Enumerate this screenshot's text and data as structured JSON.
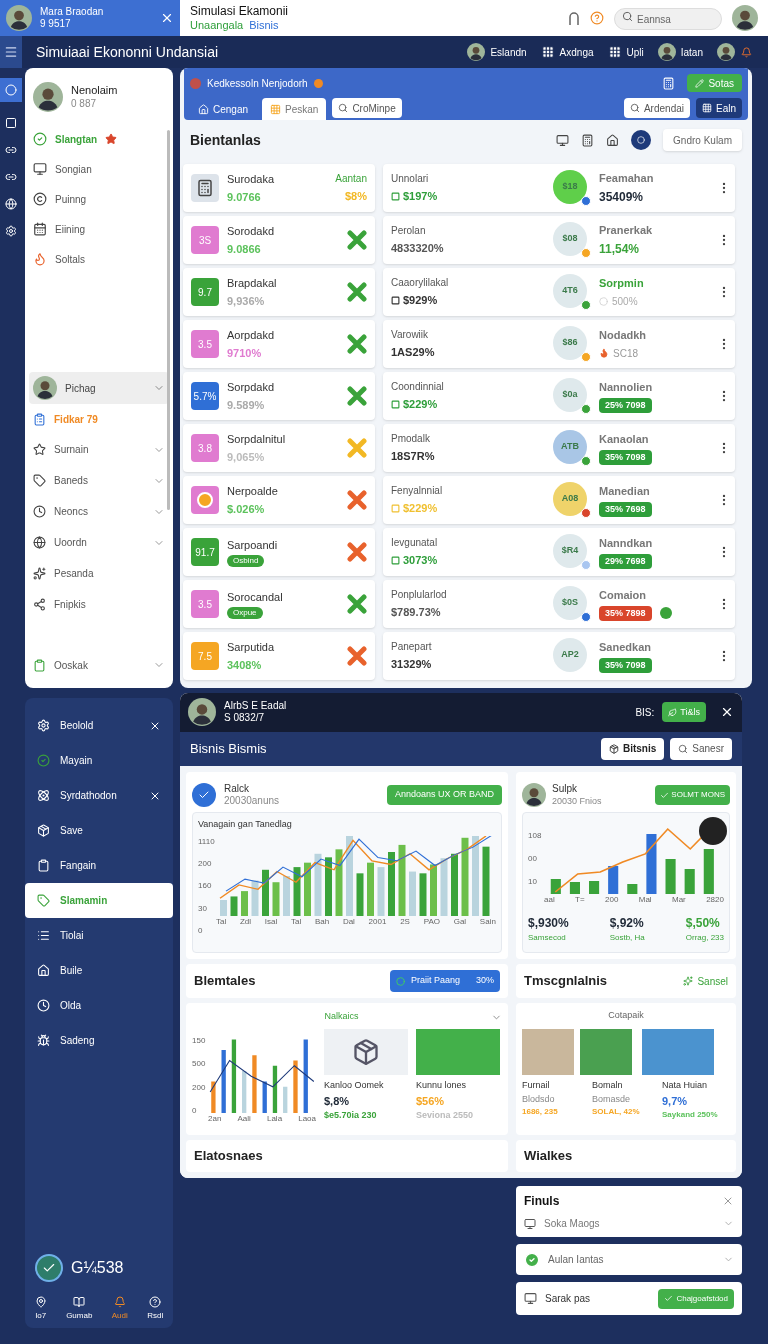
{
  "top_bar": {
    "user_name": "Mara Braodan",
    "user_id": "9 9517",
    "title": "Simulasi Ekamonii",
    "subtitle_first": "Unaangala",
    "subtitle_second": "Bisnis",
    "search_placeholder": "Eannsa"
  },
  "header": {
    "title": "Simuiaai Ekononni Undansiai",
    "items": [
      {
        "kind": "avatar",
        "label": "Eslandn"
      },
      {
        "kind": "square",
        "label": "Axdnga"
      },
      {
        "kind": "square",
        "label": "Upli"
      },
      {
        "kind": "avatar",
        "label": "Iatan"
      }
    ]
  },
  "sidebar": {
    "name": "Nenolaim",
    "id": "0 887",
    "items": [
      {
        "label": "Slangtan",
        "selected": true,
        "starred": true
      },
      {
        "label": "Songian",
        "selected": false,
        "starred": false
      },
      {
        "label": "Puinng",
        "selected": false,
        "starred": false
      },
      {
        "label": "Eiining",
        "selected": false,
        "starred": false
      },
      {
        "label": "Soltals",
        "selected": false,
        "starred": false
      }
    ],
    "group": "Pichag",
    "highlight": "Fidkar 79",
    "sub_items": [
      {
        "label": "Surnain",
        "chevron": true
      },
      {
        "label": "Baneds",
        "chevron": true
      },
      {
        "label": "Neoncs",
        "chevron": true
      },
      {
        "label": "Uoordn",
        "chevron": true
      },
      {
        "label": "Pesanda",
        "chevron": false
      },
      {
        "label": "Fnipkis",
        "chevron": false
      }
    ],
    "footer_item": "Ooskak"
  },
  "panel": {
    "title": "Kedkessoln Nenjodorh",
    "action": "Sotas",
    "tabs": [
      {
        "label": "Cengan",
        "selected": false
      },
      {
        "label": "Peskan",
        "selected": true
      }
    ],
    "filter": "CroMinpe",
    "search": "Ardendai",
    "view_button": "Ealn"
  },
  "list": {
    "title": "Bientanlas",
    "button": "Gndro Kulam",
    "rows": [
      {
        "thumb": {
          "kind": "register"
        },
        "name": "Surodaka",
        "value": {
          "kind": "text",
          "text": "9.0766",
          "color": "#5cc25c"
        },
        "status": {
          "kind": "note",
          "note": "Aantan",
          "note_value": "$8%"
        },
        "label": "Unnolari",
        "value2": {
          "text": "$197%",
          "color": "#2e9e3a",
          "icon": true
        },
        "badge": {
          "text": "$18",
          "color": "#5fcf4a"
        },
        "dot": {
          "color": "#2f6fd6"
        },
        "label3": {
          "text": "Feamahan",
          "color": "#777777"
        },
        "value3": {
          "kind": "text",
          "text": "35409%",
          "color": "#1f2937"
        },
        "extra_dot": false
      },
      {
        "thumb": {
          "kind": "text",
          "text": "3S",
          "color": "#e07bd0"
        },
        "name": "Sorodakd",
        "value": {
          "kind": "text",
          "text": "9.0866",
          "color": "#5cc25c"
        },
        "status": {
          "kind": "ok"
        },
        "label": "Perolan",
        "value2": {
          "text": "4833320%",
          "color": "#555555",
          "icon": false
        },
        "badge": {
          "text": "$08",
          "color": "#dfe9ec"
        },
        "dot": {
          "color": "#f5a623"
        },
        "label3": {
          "text": "Pranerkak",
          "color": "#777777"
        },
        "value3": {
          "kind": "text",
          "text": "11,54%",
          "color": "#3aa33a"
        },
        "extra_dot": false
      },
      {
        "thumb": {
          "kind": "text",
          "text": "9.7",
          "color": "#3aa33a"
        },
        "name": "Brapdakal",
        "value": {
          "kind": "text",
          "text": "9,936%",
          "color": "#aaaaaa"
        },
        "status": {
          "kind": "ok"
        },
        "label": "Caaorylilakal",
        "value2": {
          "text": "$929%",
          "color": "#333333",
          "icon": true
        },
        "badge": {
          "text": "4T6",
          "color": "#dfe9ec"
        },
        "dot": {
          "color": "#3aa33a"
        },
        "label3": {
          "text": "Sorpmin",
          "color": "#3aa33a"
        },
        "value3": {
          "kind": "spinner",
          "text": "500%",
          "color": "#aaaaaa"
        },
        "extra_dot": false
      },
      {
        "thumb": {
          "kind": "text",
          "text": "3.5",
          "color": "#e07bd0"
        },
        "name": "Aorpdakd",
        "value": {
          "kind": "text",
          "text": "9710%",
          "color": "#e07bd0"
        },
        "status": {
          "kind": "ok"
        },
        "label": "Varowiik",
        "value2": {
          "text": "1AS29%",
          "color": "#333333",
          "icon": false
        },
        "badge": {
          "text": "$86",
          "color": "#dfe9ec"
        },
        "dot": {
          "color": "#f5a623"
        },
        "label3": {
          "text": "Nodadkh",
          "color": "#777777"
        },
        "value3": {
          "kind": "flame",
          "text": "SC18",
          "color": "#999999"
        },
        "extra_dot": false
      },
      {
        "thumb": {
          "kind": "text",
          "text": "5.7%",
          "color": "#2f6fd6"
        },
        "name": "Sorpdakd",
        "value": {
          "kind": "text",
          "text": "9.589%",
          "color": "#aaaaaa"
        },
        "status": {
          "kind": "ok"
        },
        "label": "Coondinnial",
        "value2": {
          "text": "$229%",
          "color": "#2e9e3a",
          "icon": true
        },
        "badge": {
          "text": "$0a",
          "color": "#dfe9ec"
        },
        "dot": {
          "color": "#3aa33a"
        },
        "label3": {
          "text": "Nannolien",
          "color": "#777777"
        },
        "value3": {
          "kind": "pill",
          "text": "25% 7098",
          "color": "#2e9e3a"
        },
        "extra_dot": false
      },
      {
        "thumb": {
          "kind": "text",
          "text": "3.8",
          "color": "#e07bd0"
        },
        "name": "Sorpdalnitul",
        "value": {
          "kind": "text",
          "text": "9,065%",
          "color": "#bbbbbb"
        },
        "status": {
          "kind": "warn"
        },
        "label": "Pmodalk",
        "value2": {
          "text": "18S7R%",
          "color": "#333333",
          "icon": false
        },
        "badge": {
          "text": "ATB",
          "color": "#a9c6e6"
        },
        "dot": {
          "color": "#3aa33a"
        },
        "label3": {
          "text": "Kanaolan",
          "color": "#777777"
        },
        "value3": {
          "kind": "pill",
          "text": "35% 7098",
          "color": "#2e9e3a"
        },
        "extra_dot": false
      },
      {
        "thumb": {
          "kind": "ball",
          "color": "#e07bd0"
        },
        "name": "Nerpoalde",
        "value": {
          "kind": "text",
          "text": "$.026%",
          "color": "#5cc25c"
        },
        "status": {
          "kind": "fail"
        },
        "label": "Fenyalnnial",
        "value2": {
          "text": "$229%",
          "color": "#f0c030",
          "icon": true
        },
        "badge": {
          "text": "A08",
          "color": "#efd36a"
        },
        "dot": {
          "color": "#d9452b"
        },
        "label3": {
          "text": "Manedian",
          "color": "#777777"
        },
        "value3": {
          "kind": "pill",
          "text": "35% 7698",
          "color": "#2e9e3a"
        },
        "extra_dot": false
      },
      {
        "thumb": {
          "kind": "text",
          "text": "91.7",
          "color": "#3aa33a"
        },
        "name": "Sarpoandi",
        "value": {
          "kind": "badge",
          "text": "Osbind",
          "color": "#3aa33a"
        },
        "status": {
          "kind": "fail"
        },
        "label": "Ievgunatal",
        "value2": {
          "text": "3073%",
          "color": "#2e9e3a",
          "icon": true
        },
        "badge": {
          "text": "$R4",
          "color": "#dfe9ec"
        },
        "dot": {
          "color": "#a9c6f0"
        },
        "label3": {
          "text": "Nanndkan",
          "color": "#777777"
        },
        "value3": {
          "kind": "pill",
          "text": "29% 7698",
          "color": "#2e9e3a"
        },
        "extra_dot": false
      },
      {
        "thumb": {
          "kind": "text",
          "text": "3.5",
          "color": "#e07bd0"
        },
        "name": "Sorocandal",
        "value": {
          "kind": "badge",
          "text": "Oxpue",
          "color": "#3aa33a"
        },
        "status": {
          "kind": "ok"
        },
        "label": "Ponplularlod",
        "value2": {
          "text": "$789.73%",
          "color": "#555555",
          "icon": false
        },
        "badge": {
          "text": "$0S",
          "color": "#dfe9ec"
        },
        "dot": {
          "color": "#2f6fd6"
        },
        "label3": {
          "text": "Comaion",
          "color": "#777777"
        },
        "value3": {
          "kind": "pill",
          "text": "35% 7898",
          "color": "#d9452b"
        },
        "extra_dot": true
      },
      {
        "thumb": {
          "kind": "text",
          "text": "7.5",
          "color": "#f5a623"
        },
        "name": "Sarputida",
        "value": {
          "kind": "text",
          "text": "3408%",
          "color": "#5cc25c"
        },
        "status": {
          "kind": "fail"
        },
        "label": "Panepart",
        "value2": {
          "text": "31329%",
          "color": "#333333",
          "icon": false
        },
        "badge": {
          "text": "AP2",
          "color": "#dfe9ec"
        },
        "label3": {
          "text": "Sanedkan",
          "color": "#777777"
        },
        "value3": {
          "kind": "pill",
          "text": "35% 7098",
          "color": "#2e9e3a"
        },
        "extra_dot": false
      }
    ]
  },
  "nav": {
    "items": [
      {
        "label": "Beolold",
        "closable": true,
        "selected": false
      },
      {
        "label": "Mayain",
        "closable": false,
        "selected": false
      },
      {
        "label": "Syrdathodon",
        "closable": true,
        "selected": false
      },
      {
        "label": "Save",
        "closable": false,
        "selected": false
      },
      {
        "label": "Fangain",
        "closable": false,
        "selected": false
      },
      {
        "label": "Slamamin",
        "closable": false,
        "selected": true
      },
      {
        "label": "Tiolai",
        "closable": false,
        "selected": false
      },
      {
        "label": "Buile",
        "closable": false,
        "selected": false
      },
      {
        "label": "Olda",
        "closable": false,
        "selected": false
      },
      {
        "label": "Sadeng",
        "closable": false,
        "selected": false
      }
    ],
    "logo": "G¼538",
    "tabs": [
      {
        "label": "Io7",
        "selected": false
      },
      {
        "label": "Gumab",
        "selected": false
      },
      {
        "label": "Audi",
        "selected": true
      },
      {
        "label": "Rsdl",
        "selected": false
      }
    ]
  },
  "business": {
    "user_name": "AlrbS E Eadal",
    "user_id": "S 0832/7",
    "status_label": "BIS:",
    "status_button": "Ti&ls",
    "title": "Bisnis Bismis",
    "button": "Bitsnis",
    "search": "Sanesr",
    "left_card": {
      "name": "Ralck",
      "sub": "20030anuns",
      "button": "Anndoans UX OR BAND",
      "chart_title": "Vanagain gan Tanedlag",
      "y_ticks": [
        "1110",
        "200",
        "160",
        "30",
        "0"
      ],
      "x_labels": [
        "Tal",
        "Zdl",
        "Isal",
        "Tal",
        "Bah",
        "Dal",
        "2001",
        "2S",
        "PAO",
        "Gal",
        "Sain"
      ]
    },
    "right_card": {
      "name": "Sulpk",
      "sub": "20030 Fnios",
      "button": "SOLMT MONS",
      "y_ticks": [
        "108",
        "00",
        "10"
      ],
      "x_labels": [
        "aal",
        "T=",
        "200",
        "Mal",
        "Mar",
        "2820"
      ],
      "stats": [
        {
          "value": "$,930%",
          "caption": "Samsecod",
          "color": "#1f2937"
        },
        {
          "value": "$,92%",
          "caption": "Sostb, Ha",
          "color": "#1f2937"
        },
        {
          "value": "$,50%",
          "caption": "Orrag, 233",
          "color": "#3aa33a"
        }
      ]
    },
    "left_section": {
      "title": "Blemtales",
      "pill": "Praiit Paang",
      "pill_value": "30%",
      "dropdown": "Nalkaics",
      "y_ticks": [
        "150",
        "500",
        "200",
        "0"
      ],
      "x_labels": [
        "2an",
        "Aali",
        "Lala",
        "Laoa"
      ],
      "items": [
        {
          "kind": "truck",
          "name": "Kanloo Oomek",
          "value": {
            "text": "$,8%",
            "color": "#1f2937"
          },
          "caption": {
            "text": "$e5.70ia 230",
            "color": "#3aa33a"
          }
        },
        {
          "kind": "photo",
          "name": "Kunnu lones",
          "value": {
            "text": "$56%",
            "color": "#f5a623"
          },
          "caption": {
            "text": "Seviona 2550",
            "color": "#bbbbbb"
          }
        }
      ]
    },
    "right_section": {
      "title": "Tmscgnlalnis",
      "link": "Sansel",
      "heading": "Cotapaik",
      "items": [
        {
          "name": "Furnail",
          "sub": {
            "kind": "plain",
            "text": "Blodsdo"
          },
          "value": {
            "text": "1686, 235",
            "color": "#f5a623"
          }
        },
        {
          "name": "Bomaln",
          "sub": {
            "kind": "plain",
            "text": "Bomasde"
          },
          "value": {
            "text": "SOLAL, 42%",
            "color": "#f5a623"
          }
        },
        {
          "name": "Nata Huian",
          "sub": {
            "kind": "figure",
            "text": "9,7%",
            "color": "#2f6fd6"
          },
          "value": {
            "text": "Saykand 250%",
            "color": "#5cc25c"
          }
        }
      ]
    },
    "footer_left": "Elatosnaes",
    "footer_right": "Wialkes"
  },
  "finance": {
    "title": "Finuls",
    "rows": [
      {
        "kind": "select",
        "label": "Soka Maogs"
      },
      {
        "kind": "check",
        "label": "Aulan Iantas"
      },
      {
        "kind": "button",
        "label": "Sarak pas",
        "button": "Chajgoafstdod"
      }
    ]
  }
}
